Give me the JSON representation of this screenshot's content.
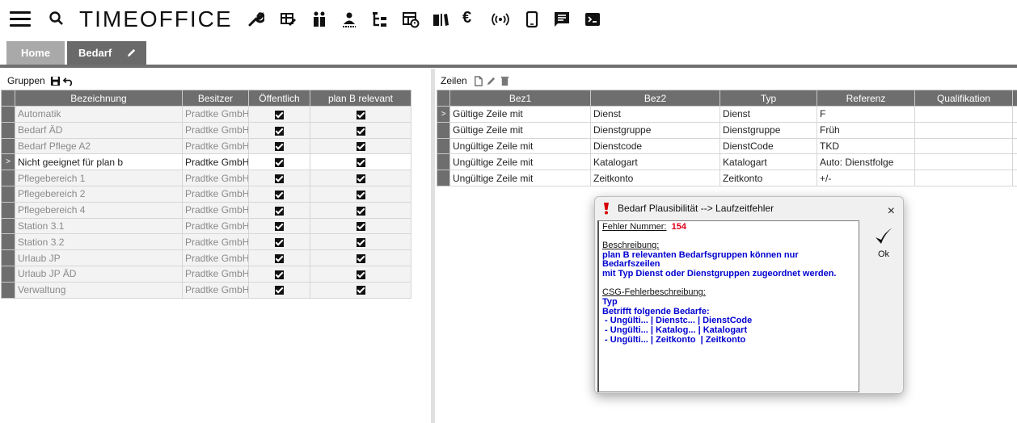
{
  "app": {
    "logo": "TIMEOFFICE",
    "toolbar_icons": [
      "wrench-icon",
      "edit-table-icon",
      "people-icon",
      "person-icon",
      "tree-icon",
      "calendar-icon",
      "book-icon",
      "euro-icon",
      "wireless-icon",
      "phone-icon",
      "chat-icon",
      "terminal-icon"
    ]
  },
  "tabs": [
    {
      "label": "Home"
    },
    {
      "label": "Bedarf"
    }
  ],
  "gruppen": {
    "title": "Gruppen",
    "columns": [
      "Bezeichnung",
      "Besitzer",
      "Öffentlich",
      "plan B relevant"
    ],
    "rows": [
      {
        "bez": "Automatik",
        "besitzer": "Pradtke GmbH",
        "oeffentlich": true,
        "planb": true,
        "active": false
      },
      {
        "bez": "Bedarf ÄD",
        "besitzer": "Pradtke GmbH",
        "oeffentlich": true,
        "planb": true,
        "active": false
      },
      {
        "bez": "Bedarf Pflege A2",
        "besitzer": "Pradtke GmbH",
        "oeffentlich": true,
        "planb": true,
        "active": false
      },
      {
        "bez": "Nicht geeignet für plan b",
        "besitzer": "Pradtke GmbH",
        "oeffentlich": true,
        "planb": true,
        "active": true
      },
      {
        "bez": "Pflegebereich 1",
        "besitzer": "Pradtke GmbH",
        "oeffentlich": true,
        "planb": true,
        "active": false
      },
      {
        "bez": "Pflegebereich 2",
        "besitzer": "Pradtke GmbH",
        "oeffentlich": true,
        "planb": true,
        "active": false
      },
      {
        "bez": "Pflegebereich 4",
        "besitzer": "Pradtke GmbH",
        "oeffentlich": true,
        "planb": true,
        "active": false
      },
      {
        "bez": "Station 3.1",
        "besitzer": "Pradtke GmbH",
        "oeffentlich": true,
        "planb": true,
        "active": false
      },
      {
        "bez": "Station 3.2",
        "besitzer": "Pradtke GmbH",
        "oeffentlich": true,
        "planb": true,
        "active": false
      },
      {
        "bez": "Urlaub JP",
        "besitzer": "Pradtke GmbH",
        "oeffentlich": true,
        "planb": true,
        "active": false
      },
      {
        "bez": "Urlaub JP ÄD",
        "besitzer": "Pradtke GmbH",
        "oeffentlich": true,
        "planb": true,
        "active": false
      },
      {
        "bez": "Verwaltung",
        "besitzer": "Pradtke GmbH",
        "oeffentlich": true,
        "planb": true,
        "active": false
      }
    ]
  },
  "zeilen": {
    "title": "Zeilen",
    "columns": [
      "Bez1",
      "Bez2",
      "Typ",
      "Referenz",
      "Qualifikation"
    ],
    "rows": [
      {
        "bez1": "Gültige Zeile mit",
        "bez2": "Dienst",
        "typ": "Dienst",
        "referenz": "F",
        "qual": ""
      },
      {
        "bez1": "Gültige Zeile mit",
        "bez2": "Dienstgruppe",
        "typ": "Dienstgruppe",
        "referenz": "Früh",
        "qual": ""
      },
      {
        "bez1": "Ungültige Zeile mit",
        "bez2": "Dienstcode",
        "typ": "DienstCode",
        "referenz": "TKD",
        "qual": ""
      },
      {
        "bez1": "Ungültige Zeile mit",
        "bez2": "Katalogart",
        "typ": "Katalogart",
        "referenz": "Auto: Dienstfolge",
        "qual": ""
      },
      {
        "bez1": "Ungültige Zeile mit",
        "bez2": "Zeitkonto",
        "typ": "Zeitkonto",
        "referenz": "+/-",
        "qual": ""
      }
    ]
  },
  "dialog": {
    "title": "Bedarf Plausibilität --> Laufzeitfehler",
    "close": "×",
    "fehler_label": "Fehler Nummer:",
    "fehler_nummer": "154",
    "beschreibung_label": "Beschreibung:",
    "beschreibung_lines": [
      "plan B relevanten Bedarfsgruppen können nur Bedarfszeilen",
      "mit Typ Dienst oder Dienstgruppen zugeordnet werden."
    ],
    "csg_label": "CSG-Fehlerbeschreibung:",
    "csg_lines": [
      "Typ",
      "Betrifft folgende Bedarfe:",
      " - Ungülti... | Dienstc... | DienstCode",
      " - Ungülti... | Katalog... | Katalogart",
      " - Ungülti... | Zeitkonto  | Zeitkonto"
    ],
    "ok_label": "Ok"
  }
}
